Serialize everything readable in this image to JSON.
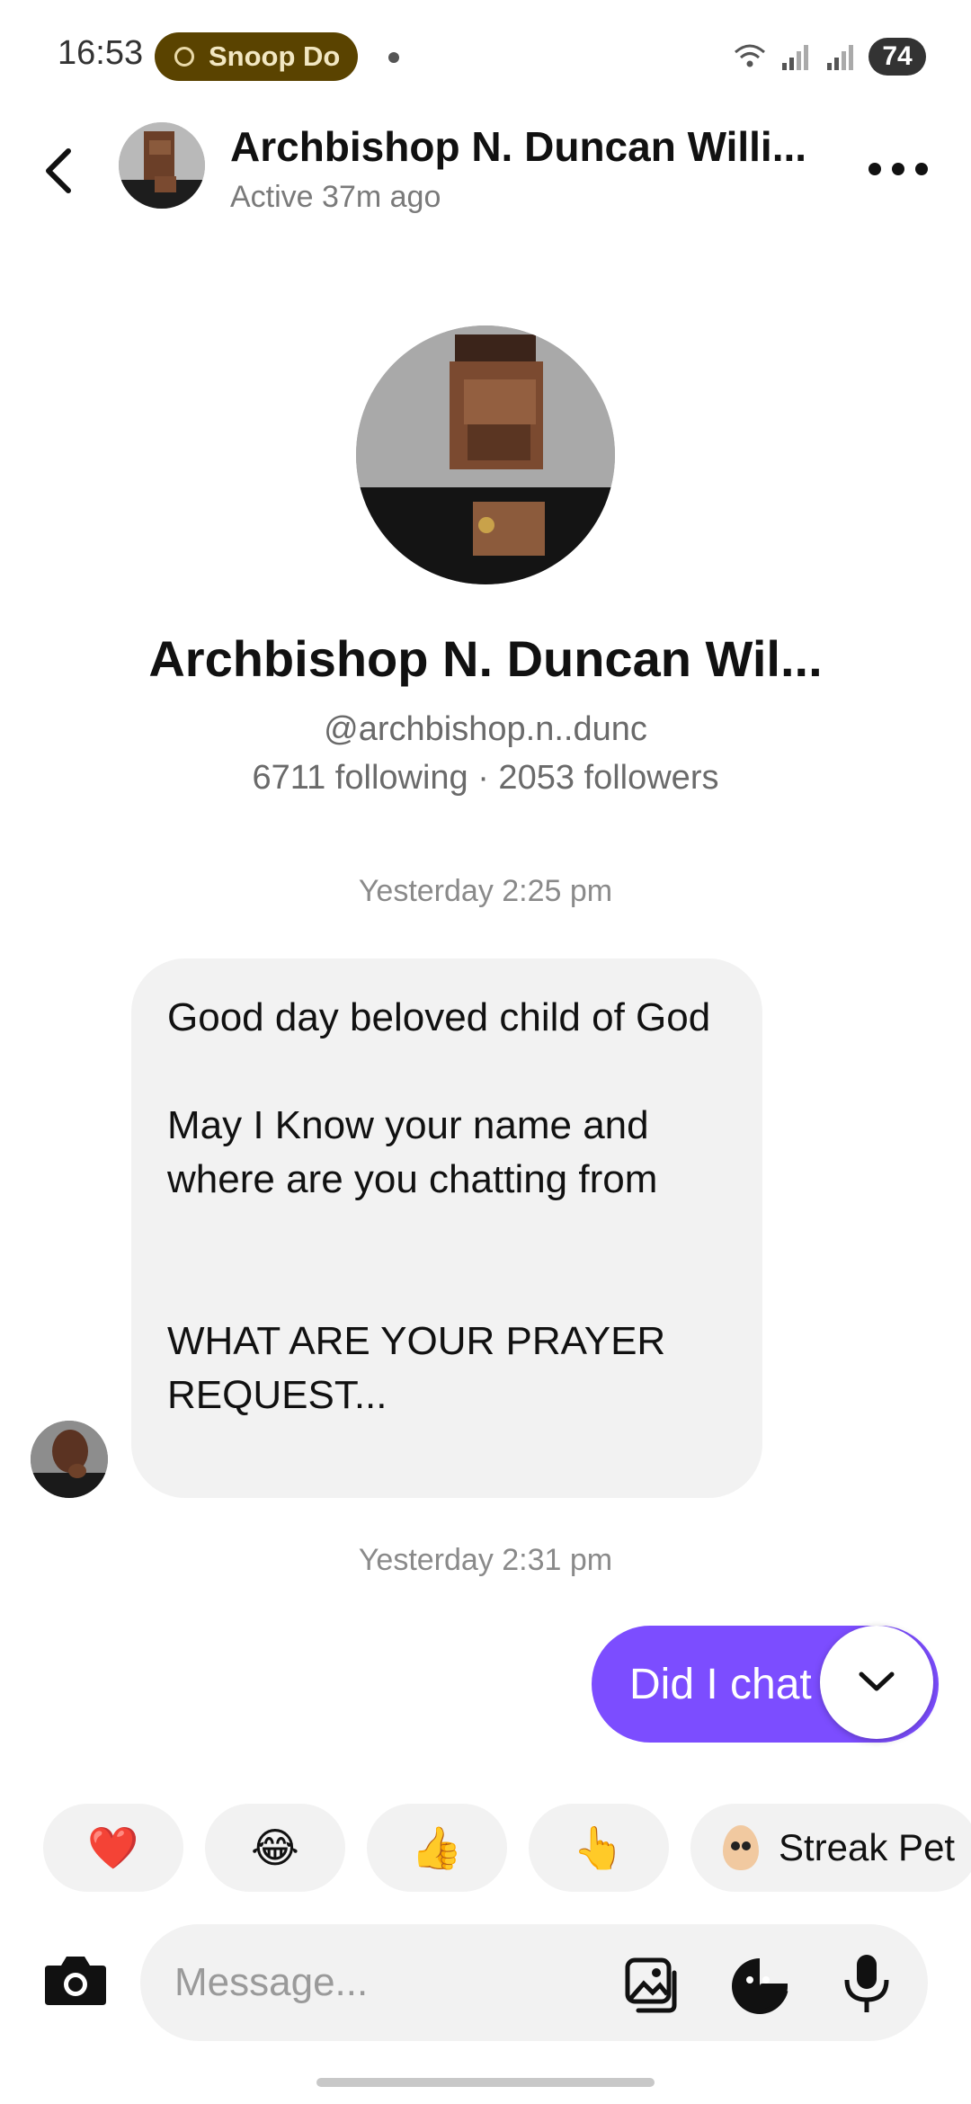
{
  "status_bar": {
    "time": "16:53",
    "media_label": "Snoop Do",
    "battery": "74"
  },
  "header": {
    "name": "Archbishop N. Duncan Willi...",
    "activity": "Active 37m ago",
    "back_icon": "chevron-left-icon",
    "more_icon": "more-horizontal-icon"
  },
  "profile": {
    "name": "Archbishop N. Duncan Wil...",
    "handle": "@archbishop.n..dunc",
    "stats": "6711 following · 2053 followers"
  },
  "conversation": {
    "timestamp_1": "Yesterday 2:25 pm",
    "incoming_message": "Good day beloved child of God\n\nMay I Know your name and where are you chatting from\n\n\nWHAT ARE YOUR PRAYER REQUEST...",
    "timestamp_2": "Yesterday 2:31 pm",
    "outgoing_message": "Did I chat"
  },
  "quick_reactions": [
    {
      "emoji": "❤️",
      "name": "heart"
    },
    {
      "emoji": "😂",
      "name": "tears-of-joy"
    },
    {
      "emoji": "👍",
      "name": "thumbs-up"
    },
    {
      "emoji": "👆",
      "name": "pointing-up"
    }
  ],
  "streak_chip": {
    "label": "Streak Pet"
  },
  "composer": {
    "placeholder": "Message..."
  },
  "colors": {
    "accent": "#7c4dff",
    "bubble_incoming": "#f2f2f2",
    "media_pill": "#5a4300"
  }
}
